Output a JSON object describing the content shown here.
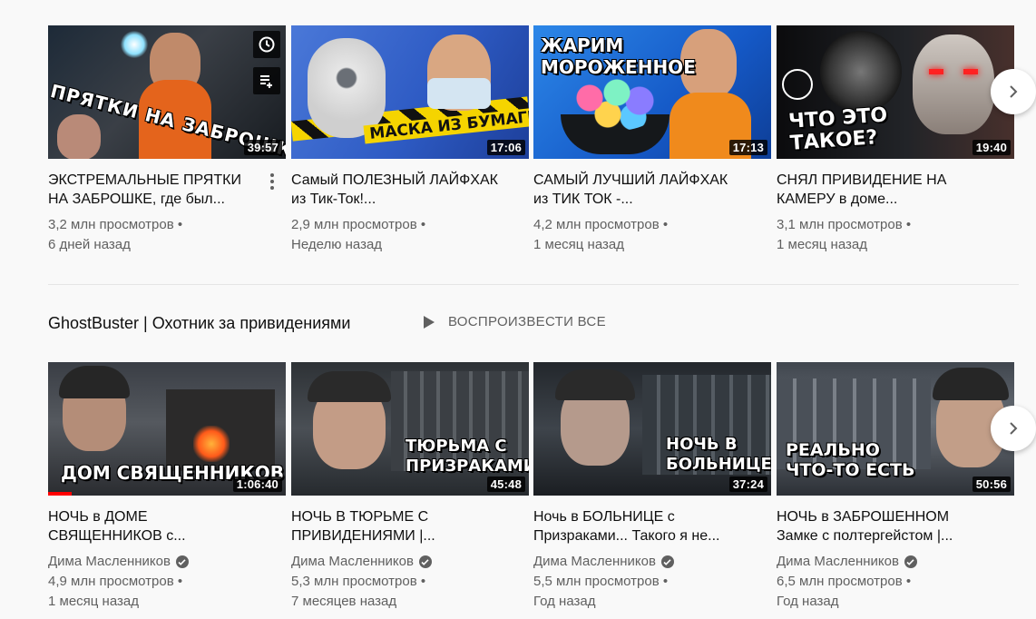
{
  "colors": {
    "accent_red": "#ff0000",
    "meta_gray": "#606060",
    "background": "#f9f9f9"
  },
  "row1": {
    "videos": [
      {
        "title": "ЭКСТРЕМАЛЬНЫЕ ПРЯТКИ НА ЗАБРОШКЕ, где был...",
        "views": "3,2 млн просмотров •",
        "age": "6 дней назад",
        "duration": "39:57",
        "thumb_text": "ПРЯТКИ НА ЗАБРОШКЕ"
      },
      {
        "title": "Самый ПОЛЕЗНЫЙ ЛАЙФХАК из Тик-Ток!...",
        "views": "2,9 млн просмотров •",
        "age": "Неделю назад",
        "duration": "17:06",
        "thumb_text": "МАСКА ИЗ БУМАГИ"
      },
      {
        "title": "САМЫЙ ЛУЧШИЙ ЛАЙФХАК из ТИК ТОК -...",
        "views": "4,2 млн просмотров •",
        "age": "1 месяц назад",
        "duration": "17:13",
        "thumb_text": "ЖАРИМ МОРОЖЕННОЕ"
      },
      {
        "title": "СНЯЛ ПРИВИДЕНИЕ НА КАМЕРУ в доме...",
        "views": "3,1 млн просмотров •",
        "age": "1 месяц назад",
        "duration": "19:40",
        "thumb_text": "ЧТО ЭТО ТАКОЕ?"
      }
    ]
  },
  "shelf": {
    "title": "GhostBuster | Охотник за привидениями",
    "play_all": "ВОСПРОИЗВЕСТИ ВСЕ"
  },
  "row2": {
    "videos": [
      {
        "title": "НОЧЬ в ДОМЕ СВЯЩЕННИКОВ с...",
        "channel": "Дима Масленников",
        "views": "4,9 млн просмотров •",
        "age": "1 месяц назад",
        "duration": "1:06:40",
        "thumb_text": "ДОМ СВЯЩЕННИКОВ",
        "watched_fraction": 0.1
      },
      {
        "title": "НОЧЬ В ТЮРЬМЕ С ПРИВИДЕНИЯМИ |...",
        "channel": "Дима Масленников",
        "views": "5,3 млн просмотров •",
        "age": "7 месяцев назад",
        "duration": "45:48",
        "thumb_text": "ТЮРЬМА С ПРИЗРАКАМИ"
      },
      {
        "title": "Ночь в БОЛЬНИЦЕ с Призраками... Такого я не...",
        "channel": "Дима Масленников",
        "views": "5,5 млн просмотров •",
        "age": "Год назад",
        "duration": "37:24",
        "thumb_text": "НОЧЬ В БОЛЬНИЦЕ"
      },
      {
        "title": "НОЧЬ в ЗАБРОШЕННОМ Замке с полтергейстом |...",
        "channel": "Дима Масленников",
        "views": "6,5 млн просмотров •",
        "age": "Год назад",
        "duration": "50:56",
        "thumb_text": "РЕАЛЬНО ЧТО-ТО ЕСТЬ"
      }
    ]
  }
}
